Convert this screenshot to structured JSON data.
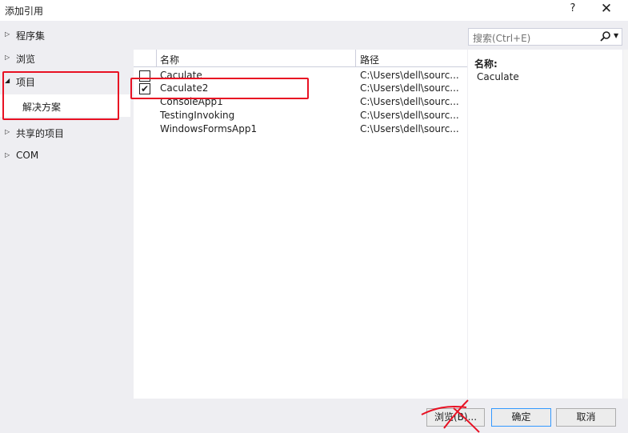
{
  "titlebar": {
    "title": "添加引用",
    "help": "?",
    "close": "✕"
  },
  "nav": {
    "items": [
      {
        "label": "程序集",
        "expanded": false
      },
      {
        "label": "浏览",
        "expanded": false
      },
      {
        "label": "项目",
        "expanded": true,
        "selected_child": "解决方案"
      },
      {
        "label": "共享的项目",
        "expanded": false
      },
      {
        "label": "COM",
        "expanded": false
      }
    ],
    "collapsed_glyph": "▷",
    "expanded_glyph": "◢"
  },
  "search": {
    "placeholder": "搜索(Ctrl+E)",
    "icon": "search-icon"
  },
  "list": {
    "columns": [
      "名称",
      "路径"
    ],
    "rows": [
      {
        "name": "Caculate",
        "path": "C:\\Users\\dell\\sourc...",
        "checked": false
      },
      {
        "name": "Caculate2",
        "path": "C:\\Users\\dell\\sourc...",
        "checked": true
      },
      {
        "name": "ConsoleApp1",
        "path": "C:\\Users\\dell\\sourc...",
        "checked": false
      },
      {
        "name": "TestingInvoking",
        "path": "C:\\Users\\dell\\sourc...",
        "checked": false
      },
      {
        "name": "WindowsFormsApp1",
        "path": "C:\\Users\\dell\\sourc...",
        "checked": false
      }
    ],
    "check_glyph": "✔"
  },
  "details": {
    "label": "名称:",
    "value": "Caculate"
  },
  "buttons": {
    "browse": "浏览(B)...",
    "ok": "确定",
    "cancel": "取消"
  },
  "annotation_color": "#e81123"
}
